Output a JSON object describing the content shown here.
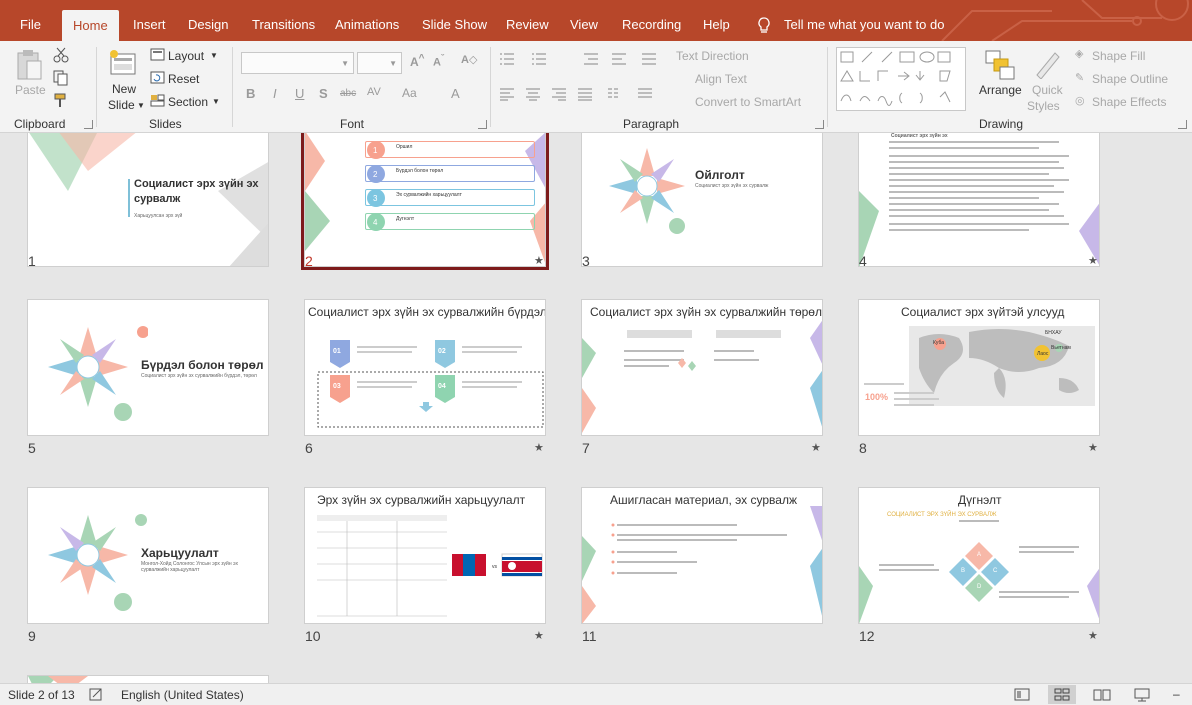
{
  "tabs": [
    {
      "key": "file",
      "label": "File"
    },
    {
      "key": "home",
      "label": "Home"
    },
    {
      "key": "insert",
      "label": "Insert"
    },
    {
      "key": "design",
      "label": "Design"
    },
    {
      "key": "transitions",
      "label": "Transitions"
    },
    {
      "key": "animations",
      "label": "Animations"
    },
    {
      "key": "slideshow",
      "label": "Slide Show"
    },
    {
      "key": "review",
      "label": "Review"
    },
    {
      "key": "view",
      "label": "View"
    },
    {
      "key": "recording",
      "label": "Recording"
    },
    {
      "key": "help",
      "label": "Help"
    }
  ],
  "tell_me": "Tell me what you want to do",
  "ribbon": {
    "clipboard": {
      "label": "Clipboard",
      "paste": "Paste"
    },
    "slides": {
      "label": "Slides",
      "new_slide_1": "New",
      "new_slide_2": "Slide",
      "layout": "Layout",
      "reset": "Reset",
      "section": "Section"
    },
    "font": {
      "label": "Font"
    },
    "paragraph": {
      "label": "Paragraph",
      "text_direction": "Text Direction",
      "align_text": "Align Text",
      "convert_smartart": "Convert to SmartArt"
    },
    "drawing": {
      "label": "Drawing",
      "arrange": "Arrange",
      "quick_styles_1": "Quick",
      "quick_styles_2": "Styles",
      "shape_fill": "Shape Fill",
      "shape_outline": "Shape Outline",
      "shape_effects": "Shape Effects"
    }
  },
  "slides": [
    {
      "num": "1",
      "title": "Социалист эрх зүйн эх сурвалж",
      "subtitle": "Харьцуулсан эрх зүй",
      "star": false,
      "selected": false
    },
    {
      "num": "2",
      "title": "",
      "items": [
        "Оршил",
        "Бүрдэл болон төрөл",
        "Эх сурвалжийн харьцуулалт",
        "Дүгнэлт"
      ],
      "star": true,
      "selected": true
    },
    {
      "num": "3",
      "title": "Ойлголт",
      "subtitle": "Социалист эрх зүйн эх сурвалж",
      "star": false,
      "selected": false
    },
    {
      "num": "4",
      "title": "",
      "text": "Социалист эрх зүйн эх",
      "star": true,
      "selected": false
    },
    {
      "num": "5",
      "title": "Бүрдэл болон төрөл",
      "subtitle": "Социалист эрх зүйн эх сурвалжийн бүрдэл, төрөл",
      "star": false,
      "selected": false
    },
    {
      "num": "6",
      "title": "Социалист эрх зүйн эх сурвалжийн бүрдэл",
      "boxes": [
        "01",
        "02",
        "03",
        "04"
      ],
      "star": true,
      "selected": false
    },
    {
      "num": "7",
      "title": "Социалист эрх зүйн эх сурвалжийн төрөл",
      "star": true,
      "selected": false
    },
    {
      "num": "8",
      "title": "Социалист эрх зүйтэй улсууд",
      "pins": [
        "БНХАУ",
        "Куба",
        "Лаос",
        "Вьетнам"
      ],
      "percent": "100%",
      "star": true,
      "selected": false
    },
    {
      "num": "9",
      "title": "Харьцуулалт",
      "subtitle": "Монгол-Хойд Солонгос Улсын эрх зүйн эх сурвалжийн харьцуулалт",
      "star": false,
      "selected": false
    },
    {
      "num": "10",
      "title": "Эрх зүйн эх сурвалжийн харьцуулалт",
      "vs": "vs",
      "star": true,
      "selected": false
    },
    {
      "num": "11",
      "title": "Ашигласан материал, эх сурвалж",
      "star": false,
      "selected": false
    },
    {
      "num": "12",
      "title": "Дүгнэлт",
      "subtitle": "СОЦИАЛИСТ ЭРХ ЗҮЙН ЭХ СУРВАЛЖ",
      "diamond": [
        "A",
        "B",
        "C",
        "D"
      ],
      "star": true,
      "selected": false
    }
  ],
  "status": {
    "slide": "Slide 2 of 13",
    "language": "English (United States)"
  },
  "colors": {
    "accent": "#b7472a",
    "selection": "#7d1b1b"
  }
}
